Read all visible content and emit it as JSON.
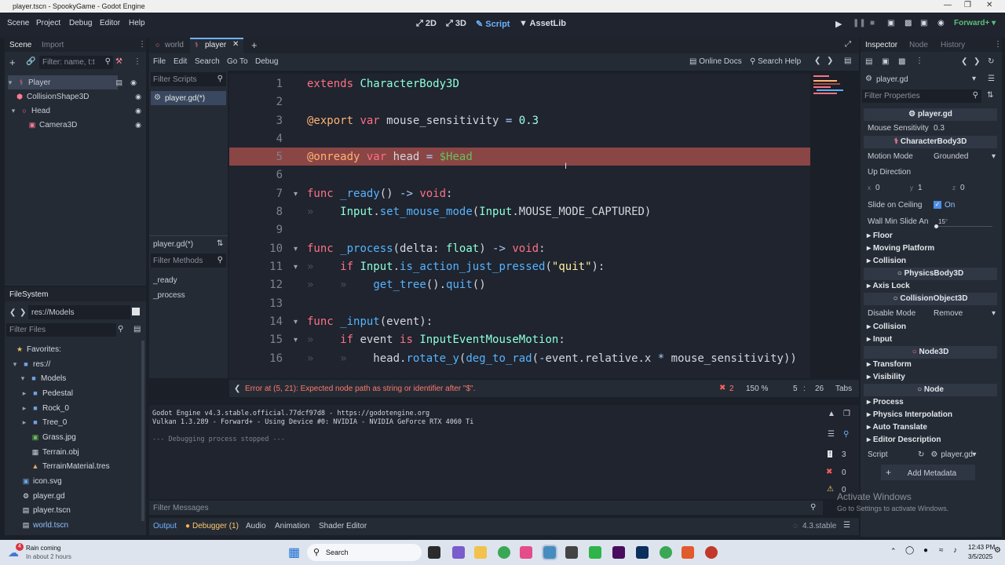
{
  "window": {
    "title": "player.tscn - SpookyGame - Godot Engine"
  },
  "menu": [
    "Scene",
    "Project",
    "Debug",
    "Editor",
    "Help"
  ],
  "workspaces": {
    "2d": "2D",
    "3d": "3D",
    "script": "Script",
    "assetlib": "AssetLib"
  },
  "renderer": "Forward+",
  "scene_dock": {
    "tabs": [
      "Scene",
      "Import"
    ],
    "filter_placeholder": "Filter: name, t:t",
    "nodes": [
      {
        "name": "Player",
        "icon": "character-body-icon"
      },
      {
        "name": "CollisionShape3D",
        "icon": "collision-shape-icon"
      },
      {
        "name": "Head",
        "icon": "node3d-icon"
      },
      {
        "name": "Camera3D",
        "icon": "camera-icon"
      }
    ]
  },
  "filesystem": {
    "title": "FileSystem",
    "path": "res://Models",
    "filter_placeholder": "Filter Files",
    "items": [
      {
        "name": "Favorites:",
        "icon": "star-icon"
      },
      {
        "name": "res://",
        "icon": "folder-icon"
      },
      {
        "name": "Models",
        "icon": "folder-icon"
      },
      {
        "name": "Pedestal",
        "icon": "folder-icon"
      },
      {
        "name": "Rock_0",
        "icon": "folder-icon"
      },
      {
        "name": "Tree_0",
        "icon": "folder-icon"
      },
      {
        "name": "Grass.jpg",
        "icon": "image-icon"
      },
      {
        "name": "Terrain.obj",
        "icon": "mesh-icon"
      },
      {
        "name": "TerrainMaterial.tres",
        "icon": "material-icon"
      },
      {
        "name": "icon.svg",
        "icon": "image-icon"
      },
      {
        "name": "player.gd",
        "icon": "script-icon"
      },
      {
        "name": "player.tscn",
        "icon": "scene-icon"
      },
      {
        "name": "world.tscn",
        "icon": "scene-icon"
      }
    ]
  },
  "editor_tabs": [
    "world",
    "player"
  ],
  "script_menu": [
    "File",
    "Edit",
    "Search",
    "Go To",
    "Debug"
  ],
  "script_tools": {
    "online_docs": "Online Docs",
    "search_help": "Search Help"
  },
  "scripts_panel": {
    "filter_placeholder": "Filter Scripts",
    "scripts": [
      "player.gd(*)"
    ],
    "current": "player.gd(*)",
    "methods_placeholder": "Filter Methods",
    "methods": [
      "_ready",
      "_process"
    ]
  },
  "code": {
    "line_numbers": [
      "1",
      "2",
      "3",
      "4",
      "5",
      "6",
      "7",
      "8",
      "9",
      "10",
      "11",
      "12",
      "13",
      "14",
      "15",
      "16"
    ]
  },
  "status": {
    "error": "Error at (5, 21): Expected node path as string or identifier after \"$\".",
    "error_count": "2",
    "zoom": "150 %",
    "line": "5",
    "col": "26",
    "indent": "Tabs"
  },
  "output": {
    "lines": [
      "Godot Engine v4.3.stable.official.77dcf97d8 - https://godotengine.org",
      "Vulkan 1.3.289 - Forward+ - Using Device #0: NVIDIA - NVIDIA GeForce RTX 4060 Ti",
      "",
      "--- Debugging process stopped ---"
    ],
    "counts": {
      "messages": "3",
      "errors": "0",
      "warnings": "0"
    },
    "filter_placeholder": "Filter Messages"
  },
  "bottom_tabs": [
    "Output",
    "Debugger (1)",
    "Audio",
    "Animation",
    "Shader Editor"
  ],
  "version": "4.3.stable",
  "inspector": {
    "tabs": [
      "Inspector",
      "Node",
      "History"
    ],
    "resource": "player.gd",
    "filter_placeholder": "Filter Properties",
    "script_header": "player.gd",
    "mouse_sensitivity_label": "Mouse Sensitivity",
    "mouse_sensitivity": "0.3",
    "class_charbody": "CharacterBody3D",
    "motion_mode_label": "Motion Mode",
    "motion_mode": "Grounded",
    "up_direction_label": "Up Direction",
    "up_x": "0",
    "up_y": "1",
    "up_z": "0",
    "slide_ceiling_label": "Slide on Ceiling",
    "slide_ceiling": "On",
    "wall_min_label": "Wall Min Slide An",
    "wall_min": "15",
    "wall_min_unit": "°",
    "groups1": [
      "Floor",
      "Moving Platform",
      "Collision"
    ],
    "class_physics": "PhysicsBody3D",
    "axis_lock": "Axis Lock",
    "class_collision": "CollisionObject3D",
    "disable_mode_label": "Disable Mode",
    "disable_mode": "Remove",
    "groups2": [
      "Collision",
      "Input"
    ],
    "class_node3d": "Node3D",
    "groups3": [
      "Transform",
      "Visibility"
    ],
    "class_node": "Node",
    "groups4": [
      "Process",
      "Physics Interpolation",
      "Auto Translate",
      "Editor Description"
    ],
    "script_label": "Script",
    "script_value": "player.gd",
    "add_metadata": "Add Metadata"
  },
  "watermark": {
    "title": "Activate Windows",
    "subtitle": "Go to Settings to activate Windows."
  },
  "taskbar": {
    "weather_title": "Rain coming",
    "weather_sub": "In about 2 hours",
    "search": "Search",
    "time": "12:43 PM",
    "date": "3/5/2025",
    "badge": "4"
  }
}
